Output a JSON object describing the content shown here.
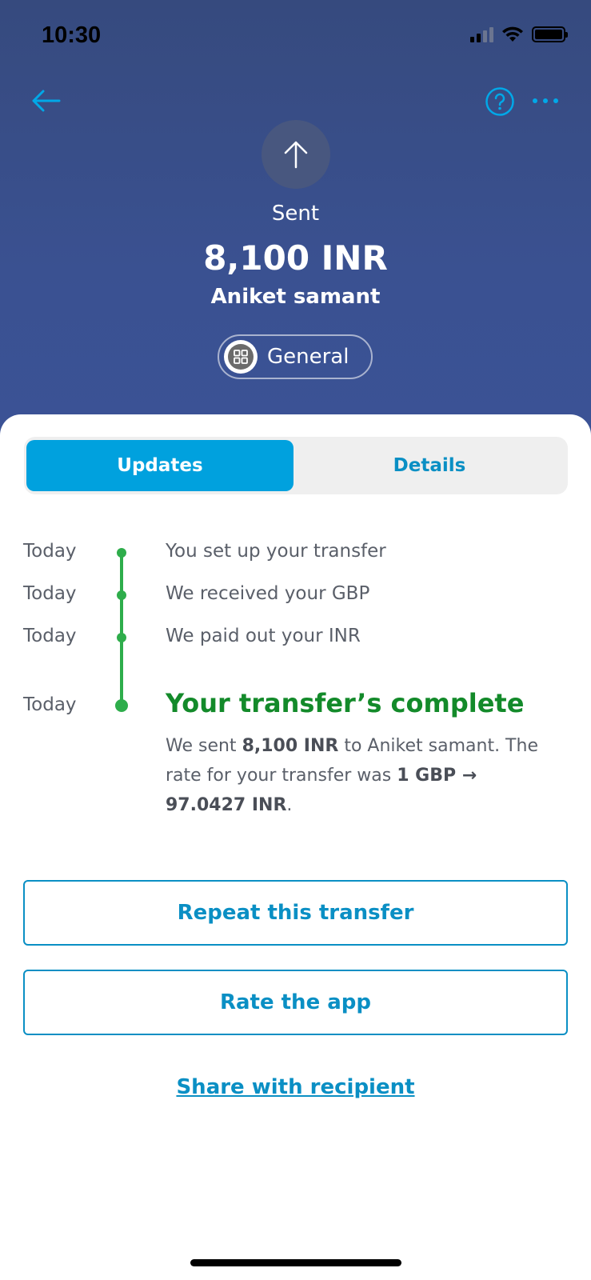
{
  "status_bar": {
    "time": "10:30"
  },
  "header": {
    "back_icon": "arrow-left-icon",
    "help_icon": "question-circle-icon",
    "more_icon": "ellipsis-icon",
    "direction_icon": "arrow-up-icon",
    "status_label": "Sent",
    "amount": "8,100 INR",
    "recipient": "Aniket samant",
    "category": {
      "icon": "grid-icon",
      "label": "General"
    }
  },
  "tabs": [
    {
      "label": "Updates",
      "active": true
    },
    {
      "label": "Details",
      "active": false
    }
  ],
  "timeline": [
    {
      "date": "Today",
      "text": "You set up your transfer"
    },
    {
      "date": "Today",
      "text": "We received your GBP"
    },
    {
      "date": "Today",
      "text": "We paid out your INR"
    },
    {
      "date": "Today",
      "text": "Your transfer’s complete"
    }
  ],
  "completion": {
    "part1": "We sent ",
    "amount": "8,100 INR",
    "part2": " to Aniket samant. The rate for your transfer was ",
    "rate": "1 GBP → 97.0427 INR",
    "part3": "."
  },
  "actions": {
    "repeat_label": "Repeat this transfer",
    "rate_label": "Rate the app",
    "share_label": "Share with recipient"
  },
  "colors": {
    "header_bg": "#3a5191",
    "accent": "#00a1de",
    "link": "#0a8fc4",
    "success": "#138a2a",
    "timeline": "#2ead4b"
  }
}
